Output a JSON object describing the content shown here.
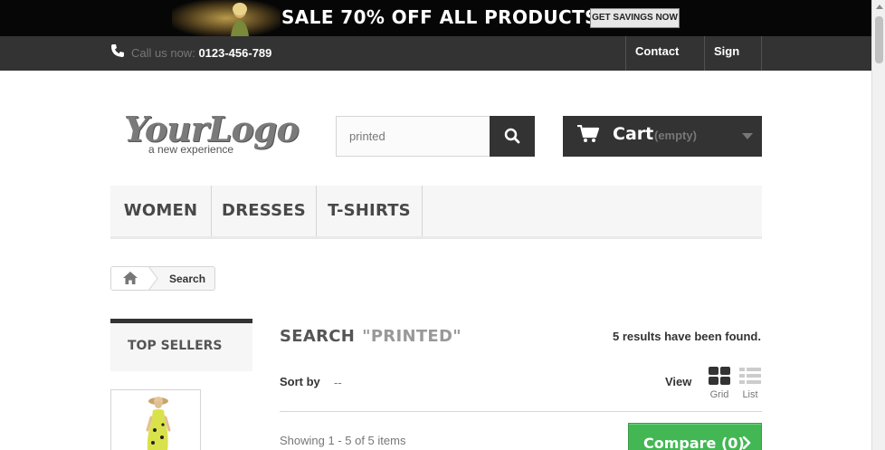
{
  "banner": {
    "sale_text": "SALE 70% OFF ALL PRODUCTS",
    "button_label": "GET SAVINGS NOW"
  },
  "navbar": {
    "call_label": "Call us now:",
    "phone_number": "0123-456-789",
    "contact_label": "Contact us",
    "signin_label": "Sign in"
  },
  "logo": {
    "main": "YourLogo",
    "tagline": "a new experience"
  },
  "search": {
    "value": "printed"
  },
  "cart": {
    "label": "Cart",
    "status": "(empty)"
  },
  "menu": {
    "items": [
      "WOMEN",
      "DRESSES",
      "T-SHIRTS"
    ]
  },
  "breadcrumb": {
    "current": "Search"
  },
  "sidebar": {
    "top_sellers_title": "TOP SELLERS"
  },
  "results": {
    "heading": "SEARCH",
    "term": "\"PRINTED\"",
    "count_text": "5 results have been found.",
    "sort_label": "Sort by",
    "sort_value": "--",
    "view_label": "View",
    "grid_label": "Grid",
    "list_label": "List",
    "showing_text": "Showing 1 - 5 of 5 items",
    "compare_label": "Compare (0)"
  },
  "colors": {
    "dark": "#333333",
    "compare_green": "#43b754",
    "banner_bg": "#060606"
  }
}
